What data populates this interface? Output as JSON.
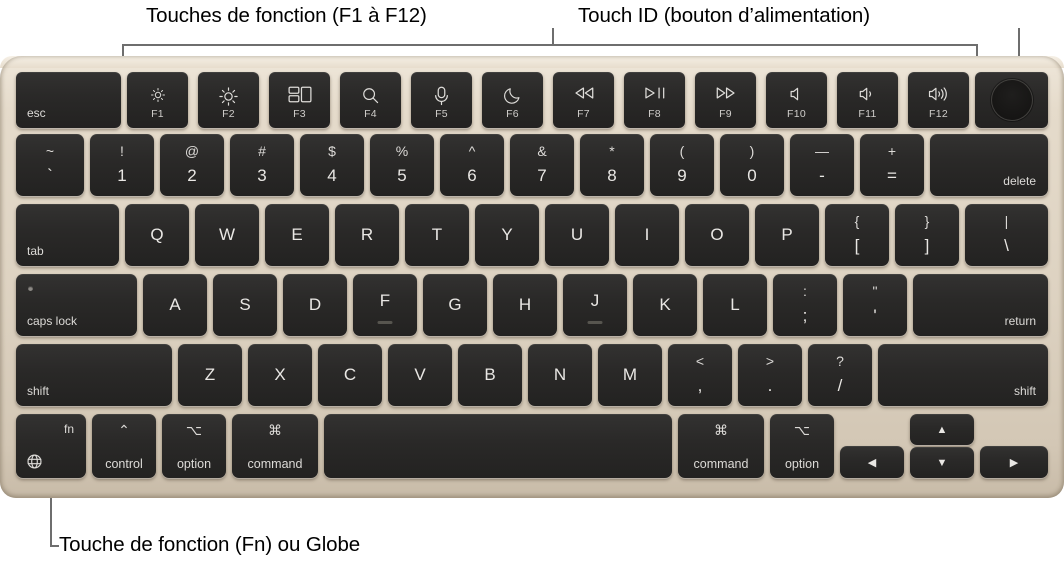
{
  "callouts": {
    "function_keys": "Touches de fonction (F1 à F12)",
    "touch_id": "Touch ID (bouton d’alimentation)",
    "fn_globe": "Touche de fonction (Fn) ou Globe"
  },
  "colors": {
    "chassis": "#ddd2c1",
    "key_face": "#2a2928",
    "key_text": "#e8e6e3",
    "callout_line": "#6e6e6e",
    "label_text": "#000000"
  },
  "keyboard": {
    "layout": "US ANSI — MacBook Air (Magic Keyboard with Touch ID)",
    "rows": {
      "function_row": [
        {
          "name": "esc",
          "label": "esc",
          "icon": ""
        },
        {
          "name": "f1",
          "label": "F1",
          "icon": "brightness-down-icon"
        },
        {
          "name": "f2",
          "label": "F2",
          "icon": "brightness-up-icon"
        },
        {
          "name": "f3",
          "label": "F3",
          "icon": "mission-control-icon"
        },
        {
          "name": "f4",
          "label": "F4",
          "icon": "spotlight-search-icon"
        },
        {
          "name": "f5",
          "label": "F5",
          "icon": "dictation-microphone-icon"
        },
        {
          "name": "f6",
          "label": "F6",
          "icon": "do-not-disturb-moon-icon"
        },
        {
          "name": "f7",
          "label": "F7",
          "icon": "rewind-icon"
        },
        {
          "name": "f8",
          "label": "F8",
          "icon": "play-pause-icon"
        },
        {
          "name": "f9",
          "label": "F9",
          "icon": "fast-forward-icon"
        },
        {
          "name": "f10",
          "label": "F10",
          "icon": "mute-icon"
        },
        {
          "name": "f11",
          "label": "F11",
          "icon": "volume-down-icon"
        },
        {
          "name": "f12",
          "label": "F12",
          "icon": "volume-up-icon"
        },
        {
          "name": "touch-id",
          "label": "",
          "icon": "touch-id-power-button-icon"
        }
      ],
      "number_row": [
        {
          "top": "~",
          "bottom": "`"
        },
        {
          "top": "!",
          "bottom": "1"
        },
        {
          "top": "@",
          "bottom": "2"
        },
        {
          "top": "#",
          "bottom": "3"
        },
        {
          "top": "$",
          "bottom": "4"
        },
        {
          "top": "%",
          "bottom": "5"
        },
        {
          "top": "^",
          "bottom": "6"
        },
        {
          "top": "&",
          "bottom": "7"
        },
        {
          "top": "*",
          "bottom": "8"
        },
        {
          "top": "(",
          "bottom": "9"
        },
        {
          "top": ")",
          "bottom": "0"
        },
        {
          "top": "—",
          "bottom": "-"
        },
        {
          "top": "+",
          "bottom": "="
        }
      ],
      "number_row_delete": "delete",
      "qwerty_row_tab": "tab",
      "qwerty_row": [
        {
          "top": "",
          "bottom": "Q"
        },
        {
          "top": "",
          "bottom": "W"
        },
        {
          "top": "",
          "bottom": "E"
        },
        {
          "top": "",
          "bottom": "R"
        },
        {
          "top": "",
          "bottom": "T"
        },
        {
          "top": "",
          "bottom": "Y"
        },
        {
          "top": "",
          "bottom": "U"
        },
        {
          "top": "",
          "bottom": "I"
        },
        {
          "top": "",
          "bottom": "O"
        },
        {
          "top": "",
          "bottom": "P"
        },
        {
          "top": "{",
          "bottom": "["
        },
        {
          "top": "}",
          "bottom": "]"
        },
        {
          "top": "|",
          "bottom": "\\"
        }
      ],
      "home_row_capslock": "caps lock",
      "home_row": [
        {
          "top": "",
          "bottom": "A"
        },
        {
          "top": "",
          "bottom": "S"
        },
        {
          "top": "",
          "bottom": "D"
        },
        {
          "top": "",
          "bottom": "F"
        },
        {
          "top": "",
          "bottom": "G"
        },
        {
          "top": "",
          "bottom": "H"
        },
        {
          "top": "",
          "bottom": "J"
        },
        {
          "top": "",
          "bottom": "K"
        },
        {
          "top": "",
          "bottom": "L"
        },
        {
          "top": ":",
          "bottom": ";"
        },
        {
          "top": "\"",
          "bottom": "'"
        }
      ],
      "home_row_return": "return",
      "shift_row_left": "shift",
      "shift_row": [
        {
          "top": "",
          "bottom": "Z"
        },
        {
          "top": "",
          "bottom": "X"
        },
        {
          "top": "",
          "bottom": "C"
        },
        {
          "top": "",
          "bottom": "V"
        },
        {
          "top": "",
          "bottom": "B"
        },
        {
          "top": "",
          "bottom": "N"
        },
        {
          "top": "",
          "bottom": "M"
        },
        {
          "top": "<",
          "bottom": ","
        },
        {
          "top": ">",
          "bottom": "."
        },
        {
          "top": "?",
          "bottom": "/"
        }
      ],
      "shift_row_right": "shift",
      "bottom_row": {
        "fn": "fn",
        "control_symbol": "⌃",
        "control": "control",
        "option_symbol": "⌥",
        "option": "option",
        "command_symbol": "⌘",
        "command": "command",
        "space": "",
        "command_right_symbol": "⌘",
        "command_right": "command",
        "option_right_symbol": "⌥",
        "option_right": "option",
        "arrow_left": "◀",
        "arrow_up": "▲",
        "arrow_down": "▼",
        "arrow_right": "▶"
      }
    }
  }
}
